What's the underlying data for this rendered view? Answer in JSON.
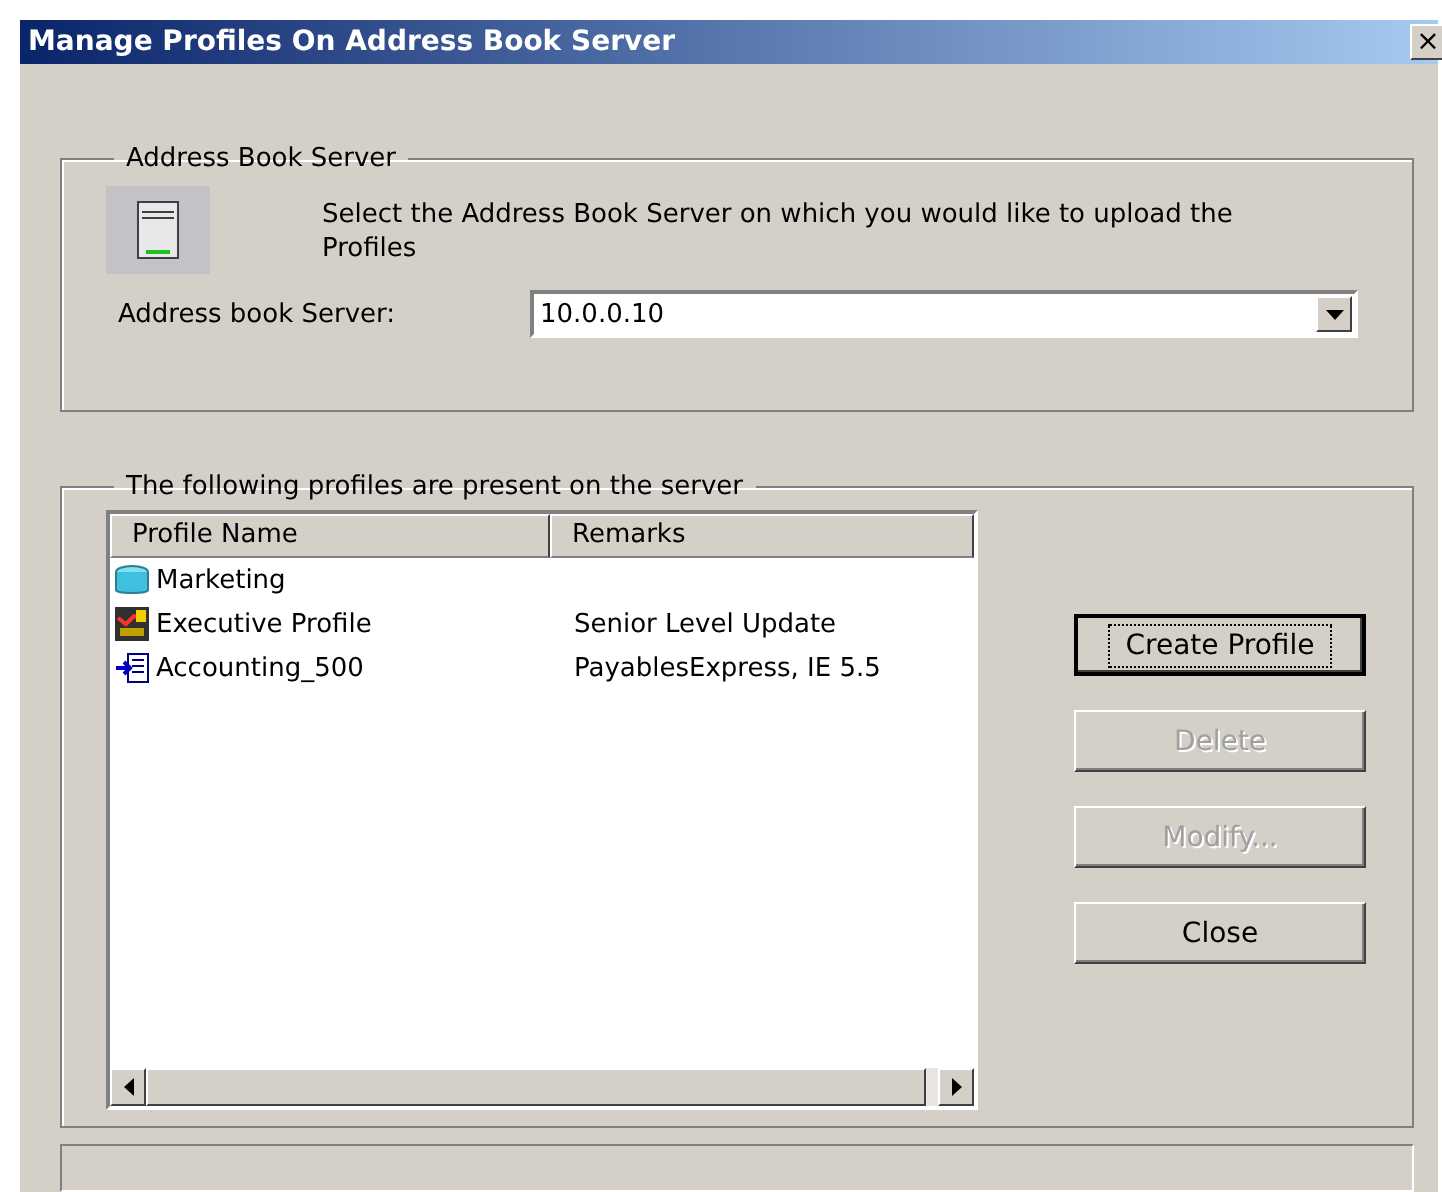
{
  "window": {
    "title": "Manage Profiles On Address Book Server",
    "close_symbol": "×"
  },
  "server_group": {
    "title": "Address Book Server",
    "description": "Select the Address Book Server on which you would like to upload the Profiles",
    "field_label": "Address book Server:",
    "value": "10.0.0.10"
  },
  "profiles_group": {
    "title": "The following profiles are present on the server",
    "columns": [
      "Profile Name",
      "Remarks"
    ],
    "rows": [
      {
        "kind": "database",
        "name": "Marketing",
        "remarks": null,
        "selected": false
      },
      {
        "kind": "chart",
        "name": "Executive Profile",
        "remarks": "Senior Level Update",
        "selected": false
      },
      {
        "kind": "import",
        "name": "Accounting_500",
        "remarks": "PayablesExpress, IE 5.5",
        "selected": false
      }
    ]
  },
  "buttons": [
    {
      "label": "Create Profile",
      "default": true,
      "disabled": false
    },
    {
      "label": "Delete",
      "default": false,
      "disabled": true
    },
    {
      "label": "Modify...",
      "default": false,
      "disabled": true
    },
    {
      "label": "Close",
      "default": false,
      "disabled": false
    }
  ]
}
